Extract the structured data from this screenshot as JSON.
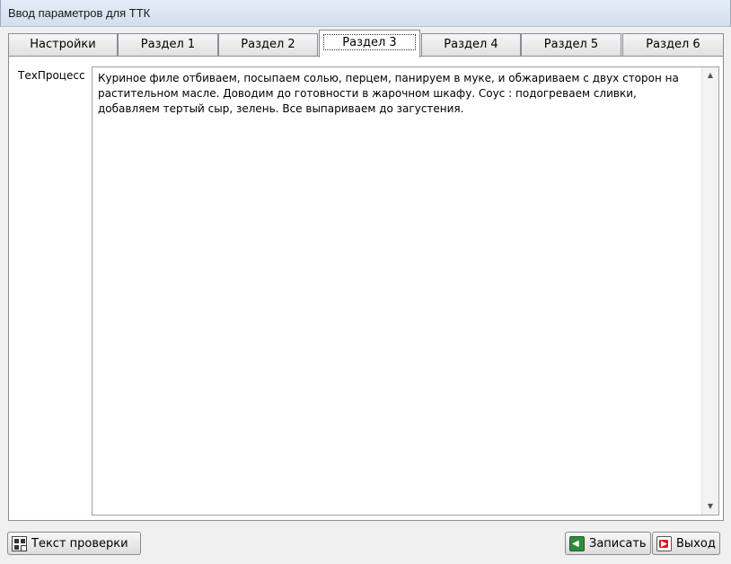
{
  "window": {
    "title": "Ввод параметров для ТТК"
  },
  "tabs": [
    {
      "label": "Настройки",
      "active": false
    },
    {
      "label": "Раздел 1",
      "active": false
    },
    {
      "label": "Раздел 2",
      "active": false
    },
    {
      "label": "Раздел 3",
      "active": true
    },
    {
      "label": "Раздел 4",
      "active": false
    },
    {
      "label": "Раздел 5",
      "active": false
    },
    {
      "label": "Раздел 6",
      "active": false
    }
  ],
  "panel": {
    "field_label": "ТехПроцесс",
    "field_value": "Куриное филе отбиваем, посыпаем солью, перцем, панируем в муке, и обжариваем с двух сторон на растительном масле. Доводим до готовности в жарочном шкафу. Соус : подогреваем сливки, добавляем тертый сыр, зелень. Все выпариваем до загустения."
  },
  "buttons": {
    "check_text": "Текст проверки",
    "save": "Записать",
    "exit": "Выход"
  },
  "icons": {
    "scroll_up": "scroll-up-arrow-icon",
    "scroll_down": "scroll-down-arrow-icon",
    "check": "qr-check-icon",
    "save": "green-arrow-save-icon",
    "exit": "red-exit-icon"
  }
}
